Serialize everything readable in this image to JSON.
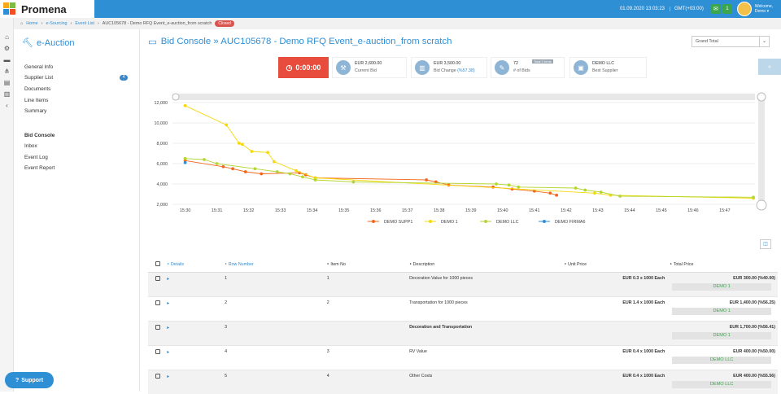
{
  "app": {
    "name": "Promena"
  },
  "topbar": {
    "datetime": "01.09.2020 13:03:23",
    "timezone": "GMT(+03:00)",
    "notification_count": "1",
    "welcome": "Welcome,",
    "user": "Demo"
  },
  "breadcrumb": {
    "home": "Home",
    "sourcing": "e-Sourcing",
    "event_list": "Event List",
    "current": "AUC105678 - Demo RFQ Event_e-auction_from scratch",
    "status": "Closed"
  },
  "sidebar": {
    "title": "e-Auction",
    "items": [
      {
        "label": "General Info"
      },
      {
        "label": "Supplier List",
        "badge": "4"
      },
      {
        "label": "Documents"
      },
      {
        "label": "Line Items"
      },
      {
        "label": "Summary"
      },
      {
        "label": "Bid Console"
      },
      {
        "label": "Inbox"
      },
      {
        "label": "Event Log"
      },
      {
        "label": "Event Report"
      }
    ],
    "support": "Support"
  },
  "header": {
    "title": "Bid Console » AUC105678 - Demo RFQ Event_e-auction_from scratch",
    "select_value": "Grand Total"
  },
  "stats": {
    "timer": "0:00:00",
    "current_bid_value": "EUR 2,600.00",
    "current_bid_label": "Current Bid",
    "bid_change_value": "EUR 3,500.00",
    "bid_change_label": "Bid Change",
    "bid_change_pct": "(%57.38)",
    "bids_value": "72",
    "bids_label": "# of Bids",
    "bids_chip": "Total 3 hrms",
    "best_supplier_value": "DEMO LLC",
    "best_supplier_label": "Best Supplier"
  },
  "chart_data": {
    "type": "line",
    "x_ticks": [
      "15:30",
      "15:31",
      "15:32",
      "15:33",
      "15:34",
      "15:35",
      "15:36",
      "15:37",
      "15:38",
      "15:39",
      "15:40",
      "15:41",
      "15:42",
      "15:43",
      "15:44",
      "15:45",
      "15:46",
      "15:47"
    ],
    "ylim": [
      2000,
      12000
    ],
    "y_ticks": [
      "2,000",
      "4,000",
      "6,000",
      "8,000",
      "10,000",
      "12,000"
    ],
    "series": [
      {
        "name": "DEMO SUPP1",
        "color": "#f4661b",
        "points": [
          [
            0.0,
            6300
          ],
          [
            1.2,
            5700
          ],
          [
            1.5,
            5500
          ],
          [
            1.9,
            5200
          ],
          [
            2.4,
            5000
          ],
          [
            3.6,
            5100
          ],
          [
            3.8,
            4900
          ],
          [
            4.1,
            4600
          ],
          [
            7.6,
            4400
          ],
          [
            7.9,
            4200
          ],
          [
            8.3,
            3900
          ],
          [
            9.7,
            3700
          ],
          [
            10.3,
            3500
          ],
          [
            11.0,
            3300
          ],
          [
            11.5,
            3100
          ],
          [
            11.7,
            2900
          ]
        ]
      },
      {
        "name": "DEMO 1",
        "color": "#f5d90a",
        "points": [
          [
            0.0,
            11700
          ],
          [
            1.3,
            9800
          ],
          [
            1.7,
            8000
          ],
          [
            1.8,
            7900
          ],
          [
            2.1,
            7200
          ],
          [
            2.6,
            7100
          ],
          [
            2.8,
            6200
          ],
          [
            3.5,
            5300
          ],
          [
            4.1,
            4600
          ],
          [
            12.9,
            3100
          ],
          [
            13.4,
            2900
          ],
          [
            17.9,
            2600
          ]
        ]
      },
      {
        "name": "DEMO LLC",
        "color": "#b4d633",
        "points": [
          [
            0.0,
            6500
          ],
          [
            0.6,
            6400
          ],
          [
            1.0,
            6000
          ],
          [
            2.2,
            5500
          ],
          [
            2.9,
            5200
          ],
          [
            3.3,
            5000
          ],
          [
            3.7,
            4700
          ],
          [
            4.1,
            4400
          ],
          [
            5.3,
            4200
          ],
          [
            9.8,
            4000
          ],
          [
            10.2,
            3900
          ],
          [
            10.5,
            3700
          ],
          [
            12.3,
            3600
          ],
          [
            12.6,
            3400
          ],
          [
            13.1,
            3200
          ],
          [
            13.7,
            2800
          ],
          [
            17.9,
            2700
          ]
        ]
      },
      {
        "name": "DEMO FIRMA6",
        "color": "#2e8fd5",
        "points": [
          [
            0.0,
            6100
          ]
        ]
      }
    ]
  },
  "table": {
    "columns": [
      "Details",
      "Row Number",
      "Item No",
      "Description",
      "Unit Price",
      "Total Price"
    ],
    "rows": [
      {
        "row": "1",
        "item": "1",
        "desc": "Decoration Value for 1000 pieces",
        "unit": "EUR 0.3 x 1000 Each",
        "total": "EUR 300.00 (%40.00)",
        "winner": "DEMO 1"
      },
      {
        "row": "2",
        "item": "2",
        "desc": "Transportation for 1000 pieces",
        "unit": "EUR 1.4 x 1000 Each",
        "total": "EUR 1,400.00 (%56.25)",
        "winner": "DEMO 1"
      },
      {
        "row": "3",
        "item": "",
        "desc": "Decoration and Transportation",
        "unit": "",
        "total": "EUR 1,700.00 (%56.41)",
        "winner": "DEMO 1"
      },
      {
        "row": "4",
        "item": "3",
        "desc": "RV Value",
        "unit": "EUR 0.4 x 1000 Each",
        "total": "EUR 400.00 (%50.00)",
        "winner": "DEMO LLC"
      },
      {
        "row": "5",
        "item": "4",
        "desc": "Other Costs",
        "unit": "EUR 0.4 x 1000 Each",
        "total": "EUR 400.00 (%55.56)",
        "winner": "DEMO LLC"
      }
    ]
  }
}
